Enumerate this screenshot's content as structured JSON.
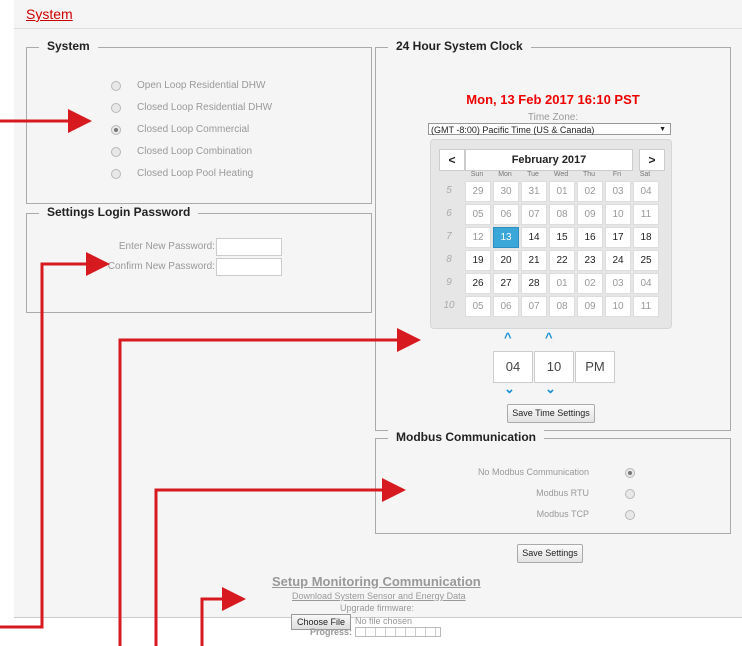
{
  "header": {
    "system_link": "System"
  },
  "system": {
    "legend": "System",
    "options": [
      {
        "label": "Open Loop Residential DHW",
        "selected": false
      },
      {
        "label": "Closed Loop Residential DHW",
        "selected": false
      },
      {
        "label": "Closed Loop Commercial",
        "selected": true
      },
      {
        "label": "Closed Loop Combination",
        "selected": false
      },
      {
        "label": "Closed Loop Pool Heating",
        "selected": false
      }
    ]
  },
  "password": {
    "legend": "Settings Login Password",
    "enter_label": "Enter New Password:",
    "confirm_label": "Confirm New Password:",
    "enter_value": "",
    "confirm_value": ""
  },
  "clock": {
    "legend": "24 Hour System Clock",
    "current": "Mon, 13 Feb 2017 16:10 PST",
    "tz_label": "Time Zone:",
    "tz_value": "(GMT -8:00) Pacific Time (US & Canada)",
    "calendar": {
      "prev": "<",
      "next": ">",
      "month": "February 2017",
      "dow": [
        "Sun",
        "Mon",
        "Tue",
        "Wed",
        "Thu",
        "Fri",
        "Sat"
      ],
      "weeks": [
        {
          "wk": "5",
          "days": [
            "29",
            "30",
            "31",
            "01",
            "02",
            "03",
            "04"
          ],
          "muted": [
            true,
            true,
            true,
            true,
            true,
            true,
            true
          ]
        },
        {
          "wk": "6",
          "days": [
            "05",
            "06",
            "07",
            "08",
            "09",
            "10",
            "11"
          ],
          "muted": [
            true,
            true,
            true,
            true,
            true,
            true,
            true
          ]
        },
        {
          "wk": "7",
          "days": [
            "12",
            "13",
            "14",
            "15",
            "16",
            "17",
            "18"
          ],
          "muted": [
            true,
            false,
            false,
            false,
            false,
            false,
            false
          ]
        },
        {
          "wk": "8",
          "days": [
            "19",
            "20",
            "21",
            "22",
            "23",
            "24",
            "25"
          ],
          "muted": [
            false,
            false,
            false,
            false,
            false,
            false,
            false
          ]
        },
        {
          "wk": "9",
          "days": [
            "26",
            "27",
            "28",
            "01",
            "02",
            "03",
            "04"
          ],
          "muted": [
            false,
            false,
            false,
            true,
            true,
            true,
            true
          ]
        },
        {
          "wk": "10",
          "days": [
            "05",
            "06",
            "07",
            "08",
            "09",
            "10",
            "11"
          ],
          "muted": [
            true,
            true,
            true,
            true,
            true,
            true,
            true
          ]
        }
      ],
      "selected_day": "13"
    },
    "hour": "04",
    "minute": "10",
    "ampm": "PM",
    "save_label": "Save Time Settings"
  },
  "modbus": {
    "legend": "Modbus Communication",
    "options": [
      {
        "label": "No Modbus Communication",
        "selected": true
      },
      {
        "label": "Modbus RTU",
        "selected": false
      },
      {
        "label": "Modbus TCP",
        "selected": false
      }
    ]
  },
  "save_settings_label": "Save Settings",
  "monitoring": {
    "title": "Setup Monitoring Communication",
    "download_link": "Download System Sensor and Energy Data",
    "upgrade_label": "Upgrade firmware:",
    "choose_file": "Choose File",
    "no_file": "No file chosen",
    "progress_label": "Progress:",
    "progress_value": 0
  },
  "colors": {
    "accent_red": "#e00000",
    "arrow_red": "#d71920",
    "selected_blue": "#3aa7d8",
    "spinner_blue": "#1a8fd6"
  }
}
